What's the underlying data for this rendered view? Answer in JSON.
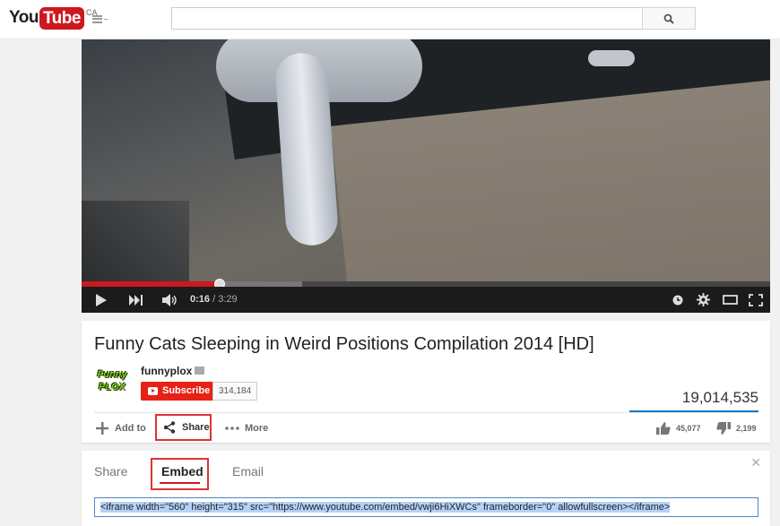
{
  "masthead": {
    "logo_you": "You",
    "logo_tube": "Tube",
    "region": "CA",
    "search_value": "",
    "search_placeholder": ""
  },
  "player": {
    "current_time": "0:16",
    "duration": "3:29",
    "progress_fraction": 0.2,
    "loaded_fraction": 0.32
  },
  "video": {
    "title": "Funny Cats Sleeping in Weird Positions Compilation 2014 [HD]",
    "channel_name": "funnyplox",
    "channel_logo_text": "Funny PLOX",
    "subscribe_label": "Subscribe",
    "subscriber_count": "314,184",
    "view_count": "19,014,535",
    "likes": "45,077",
    "dislikes": "2,199"
  },
  "actions": {
    "add_to": "Add to",
    "share": "Share",
    "more": "More"
  },
  "share_panel": {
    "tabs": [
      "Share",
      "Embed",
      "Email"
    ],
    "active_tab": "Embed",
    "embed_code": "<iframe width=\"560\" height=\"315\" src=\"https://www.youtube.com/embed/vwji6HiXWCs\" frameborder=\"0\" allowfullscreen></iframe>"
  },
  "colors": {
    "brand_red": "#cc181e",
    "subscribe_red": "#e62117",
    "highlight_box": "#dd3333",
    "selection": "#b4d1f7"
  }
}
